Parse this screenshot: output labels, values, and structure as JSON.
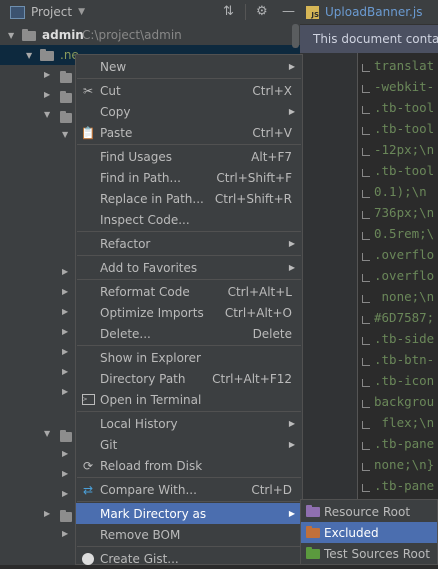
{
  "project_panel": {
    "title": "Project",
    "tree": {
      "root_name": "admin",
      "root_path": "C:\\project\\admin",
      "selected_folder": ".ne"
    }
  },
  "editor": {
    "tab_label": "UploadBanner.js",
    "tab_icon_text": "JS",
    "notice": "This document contains",
    "code_lines": [
      "translat",
      "-webkit-",
      ".tb-tool",
      ".tb-tool",
      "-12px;\\n",
      ".tb-tool",
      "0.1);\\n",
      "736px;\\n",
      "0.5rem;\\",
      ".overflo",
      ".overflo",
      " none;\\n",
      "#6D7587;",
      ".tb-side",
      ".tb-btn-",
      ".tb-icon",
      "backgrou",
      " flex;\\n",
      ".tb-pane",
      "none;\\n}",
      ".tb-pane"
    ]
  },
  "context_menu": {
    "new": "New",
    "cut": "Cut",
    "cut_shortcut": "Ctrl+X",
    "copy": "Copy",
    "paste": "Paste",
    "paste_shortcut": "Ctrl+V",
    "find_usages": "Find Usages",
    "find_usages_shortcut": "Alt+F7",
    "find_in_path": "Find in Path...",
    "find_in_path_shortcut": "Ctrl+Shift+F",
    "replace_in_path": "Replace in Path...",
    "replace_in_path_shortcut": "Ctrl+Shift+R",
    "inspect_code": "Inspect Code...",
    "refactor": "Refactor",
    "add_to_favorites": "Add to Favorites",
    "reformat_code": "Reformat Code",
    "reformat_code_shortcut": "Ctrl+Alt+L",
    "optimize_imports": "Optimize Imports",
    "optimize_imports_shortcut": "Ctrl+Alt+O",
    "delete": "Delete...",
    "delete_shortcut": "Delete",
    "show_in_explorer": "Show in Explorer",
    "directory_path": "Directory Path",
    "directory_path_shortcut": "Ctrl+Alt+F12",
    "open_in_terminal": "Open in Terminal",
    "local_history": "Local History",
    "git": "Git",
    "reload_from_disk": "Reload from Disk",
    "compare_with": "Compare With...",
    "compare_with_shortcut": "Ctrl+D",
    "mark_directory_as": "Mark Directory as",
    "remove_bom": "Remove BOM",
    "create_gist": "Create Gist..."
  },
  "submenu": {
    "resource_root": "Resource Root",
    "excluded": "Excluded",
    "test_sources_root": "Test Sources Root"
  },
  "colors": {
    "menu_highlight": "#4b6eaf",
    "resource_root_folder": "#8f6fb0",
    "excluded_folder": "#c0703b",
    "test_sources_folder": "#5b9a3e"
  }
}
